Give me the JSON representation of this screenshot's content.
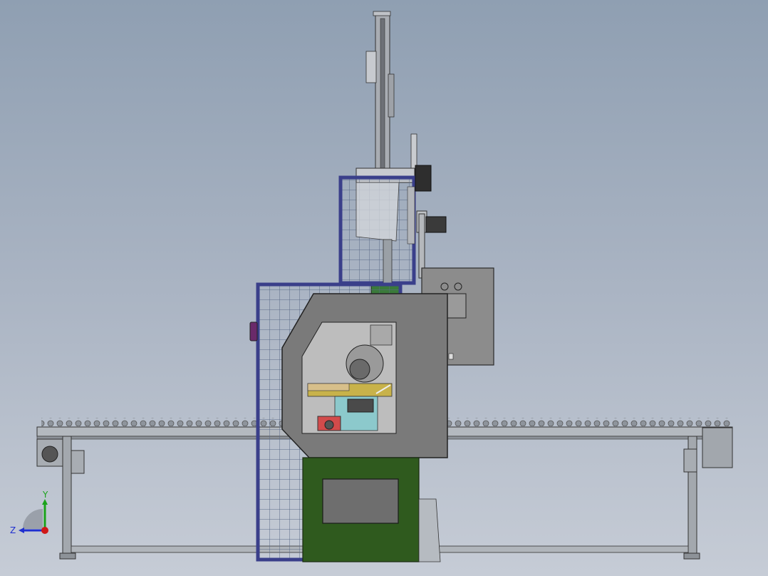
{
  "viewport": {
    "background_top": "#8f9fb2",
    "background_bottom": "#c6ccd6"
  },
  "triad": {
    "y_label": "Y",
    "z_label": "Z",
    "y_color": "#1aa31a",
    "z_color": "#1f2fd0",
    "x_color": "#d01818"
  },
  "colors": {
    "guard_frame": "#3a3f8a",
    "guard_mesh": "#6b7a93",
    "housing": "#7a7a7a",
    "base_cabinet": "#2f5a1e",
    "control_box": "#8c8c8c",
    "conveyor": "#9aa0a8",
    "blue_clamp": "#8cc9cc",
    "yellow_table": "#c8b24a",
    "motor_red": "#d24b4b"
  }
}
